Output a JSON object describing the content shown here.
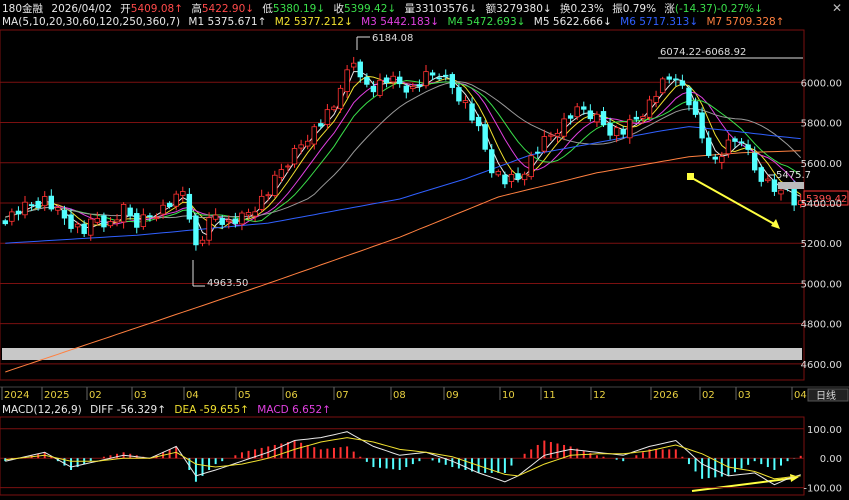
{
  "header": {
    "code": "180金融",
    "date": "2026/04/02",
    "open_label": "开",
    "open": "5409.08↑",
    "high_label": "高",
    "high": "5422.90↓",
    "low_label": "低",
    "low": "5380.19↓",
    "close_label": "收",
    "close": "5399.42↓",
    "vol_label": "量",
    "vol": "33103576↓",
    "amt_label": "额",
    "amt": "3279380↓",
    "turnover_label": "换",
    "turnover": "0.23%",
    "amp_label": "振",
    "amp": "0.79%",
    "chg_label": "涨",
    "chg": "(-14.37)-0.27%↓"
  },
  "ma_row": {
    "label": "MA(5,10,20,30,60,120,250,360,7)",
    "items": [
      {
        "name": "M1",
        "value": "5375.671↑",
        "color": "#e8e8e8"
      },
      {
        "name": "M2",
        "value": "5377.212↓",
        "color": "#f0e030"
      },
      {
        "name": "M3",
        "value": "5442.183↓",
        "color": "#e040e0"
      },
      {
        "name": "M4",
        "value": "5472.693↓",
        "color": "#3adf4a"
      },
      {
        "name": "M5",
        "value": "5622.666↓",
        "color": "#9a9a9a"
      },
      {
        "name": "M6",
        "value": "5717.313↓",
        "color": "#3060ff"
      },
      {
        "name": "M7",
        "value": "5709.328↑",
        "color": "#ff8040"
      }
    ]
  },
  "macd_row": {
    "label": "MACD(12,26,9)",
    "diff_label": "DIFF",
    "diff": "-56.329↑",
    "dea_label": "DEA",
    "dea": "-59.655↑",
    "macd_label": "MACD",
    "macd": "6.652↑"
  },
  "annotations": {
    "high_mark": "6184.08",
    "low_mark": "4963.50",
    "range_mark": "6074.22-6068.92",
    "right_mark": "5475.7",
    "last_price": "5399.42"
  },
  "period_label": "日线",
  "colors": {
    "up": "#ff3232",
    "down": "#54ffff",
    "grid": "#7a1010",
    "arrow": "#ffff40"
  },
  "chart_data": [
    {
      "type": "candlestick",
      "title": "180金融",
      "x_ticks": [
        "2024",
        "2025",
        "02",
        "03",
        "04",
        "05",
        "06",
        "07",
        "08",
        "09",
        "10",
        "11",
        "12",
        "2026",
        "02",
        "03",
        "04"
      ],
      "y_ticks": [
        4600,
        4800,
        5000,
        5200,
        5400,
        5600,
        5800,
        6000
      ],
      "ylim": [
        4520,
        6260
      ],
      "close_path": [
        [
          0,
          5330
        ],
        [
          3,
          5380
        ],
        [
          6,
          5420
        ],
        [
          8,
          5350
        ],
        [
          10,
          5300
        ],
        [
          12,
          5260
        ],
        [
          14,
          5320
        ],
        [
          16,
          5290
        ],
        [
          18,
          5360
        ],
        [
          20,
          5300
        ],
        [
          22,
          5340
        ],
        [
          24,
          5380
        ],
        [
          26,
          5420
        ],
        [
          27,
          5460
        ],
        [
          28,
          5350
        ],
        [
          29,
          5180
        ],
        [
          30,
          5230
        ],
        [
          31,
          5300
        ],
        [
          32,
          5340
        ],
        [
          34,
          5300
        ],
        [
          36,
          5320
        ],
        [
          38,
          5380
        ],
        [
          40,
          5450
        ],
        [
          42,
          5560
        ],
        [
          44,
          5650
        ],
        [
          46,
          5740
        ],
        [
          48,
          5800
        ],
        [
          50,
          5880
        ],
        [
          51,
          6000
        ],
        [
          52,
          6050
        ],
        [
          53,
          6110
        ],
        [
          54,
          6000
        ],
        [
          56,
          5980
        ],
        [
          58,
          6010
        ],
        [
          60,
          5990
        ],
        [
          62,
          5960
        ],
        [
          64,
          6020
        ],
        [
          66,
          6040
        ],
        [
          68,
          5980
        ],
        [
          70,
          5900
        ],
        [
          72,
          5760
        ],
        [
          74,
          5580
        ],
        [
          76,
          5510
        ],
        [
          78,
          5520
        ],
        [
          80,
          5620
        ],
        [
          82,
          5700
        ],
        [
          84,
          5770
        ],
        [
          86,
          5830
        ],
        [
          88,
          5860
        ],
        [
          90,
          5820
        ],
        [
          92,
          5770
        ],
        [
          94,
          5760
        ],
        [
          96,
          5820
        ],
        [
          98,
          5900
        ],
        [
          100,
          5990
        ],
        [
          102,
          6040
        ],
        [
          104,
          5900
        ],
        [
          106,
          5720
        ],
        [
          108,
          5600
        ],
        [
          110,
          5680
        ],
        [
          112,
          5720
        ],
        [
          114,
          5570
        ],
        [
          116,
          5510
        ],
        [
          118,
          5440
        ],
        [
          119,
          5480
        ],
        [
          120,
          5420
        ],
        [
          121,
          5399
        ]
      ],
      "series": [
        {
          "name": "M1",
          "value": "5375.671"
        },
        {
          "name": "M2",
          "value": "5377.212"
        },
        {
          "name": "M3",
          "value": "5442.183"
        },
        {
          "name": "M4",
          "value": "5472.693"
        },
        {
          "name": "M5",
          "value": "5622.666"
        },
        {
          "name": "M6",
          "value": "5717.313"
        },
        {
          "name": "M7",
          "value": "5709.328"
        }
      ]
    },
    {
      "type": "macd",
      "title": "MACD(12,26,9)",
      "y_ticks": [
        100,
        0,
        -100
      ],
      "ylim": [
        -125,
        140
      ],
      "diff_path": [
        [
          0,
          -10
        ],
        [
          6,
          20
        ],
        [
          10,
          -30
        ],
        [
          14,
          -10
        ],
        [
          18,
          10
        ],
        [
          22,
          0
        ],
        [
          26,
          40
        ],
        [
          29,
          -60
        ],
        [
          32,
          -40
        ],
        [
          36,
          -10
        ],
        [
          40,
          20
        ],
        [
          44,
          60
        ],
        [
          48,
          70
        ],
        [
          52,
          90
        ],
        [
          56,
          40
        ],
        [
          60,
          10
        ],
        [
          64,
          20
        ],
        [
          68,
          -10
        ],
        [
          72,
          -50
        ],
        [
          76,
          -80
        ],
        [
          78,
          -60
        ],
        [
          82,
          10
        ],
        [
          86,
          30
        ],
        [
          90,
          20
        ],
        [
          94,
          10
        ],
        [
          98,
          40
        ],
        [
          102,
          60
        ],
        [
          106,
          -20
        ],
        [
          110,
          -60
        ],
        [
          114,
          -50
        ],
        [
          117,
          -90
        ],
        [
          119,
          -70
        ],
        [
          121,
          -56
        ]
      ],
      "dea_path": [
        [
          0,
          -5
        ],
        [
          6,
          10
        ],
        [
          10,
          -10
        ],
        [
          14,
          -10
        ],
        [
          18,
          0
        ],
        [
          22,
          0
        ],
        [
          26,
          20
        ],
        [
          29,
          -20
        ],
        [
          32,
          -30
        ],
        [
          36,
          -20
        ],
        [
          40,
          0
        ],
        [
          44,
          30
        ],
        [
          48,
          55
        ],
        [
          52,
          70
        ],
        [
          56,
          55
        ],
        [
          60,
          30
        ],
        [
          64,
          20
        ],
        [
          68,
          5
        ],
        [
          72,
          -25
        ],
        [
          76,
          -55
        ],
        [
          78,
          -60
        ],
        [
          82,
          -20
        ],
        [
          86,
          10
        ],
        [
          90,
          15
        ],
        [
          94,
          15
        ],
        [
          98,
          25
        ],
        [
          102,
          45
        ],
        [
          106,
          15
        ],
        [
          110,
          -30
        ],
        [
          114,
          -45
        ],
        [
          117,
          -70
        ],
        [
          119,
          -65
        ],
        [
          121,
          -60
        ]
      ]
    }
  ]
}
